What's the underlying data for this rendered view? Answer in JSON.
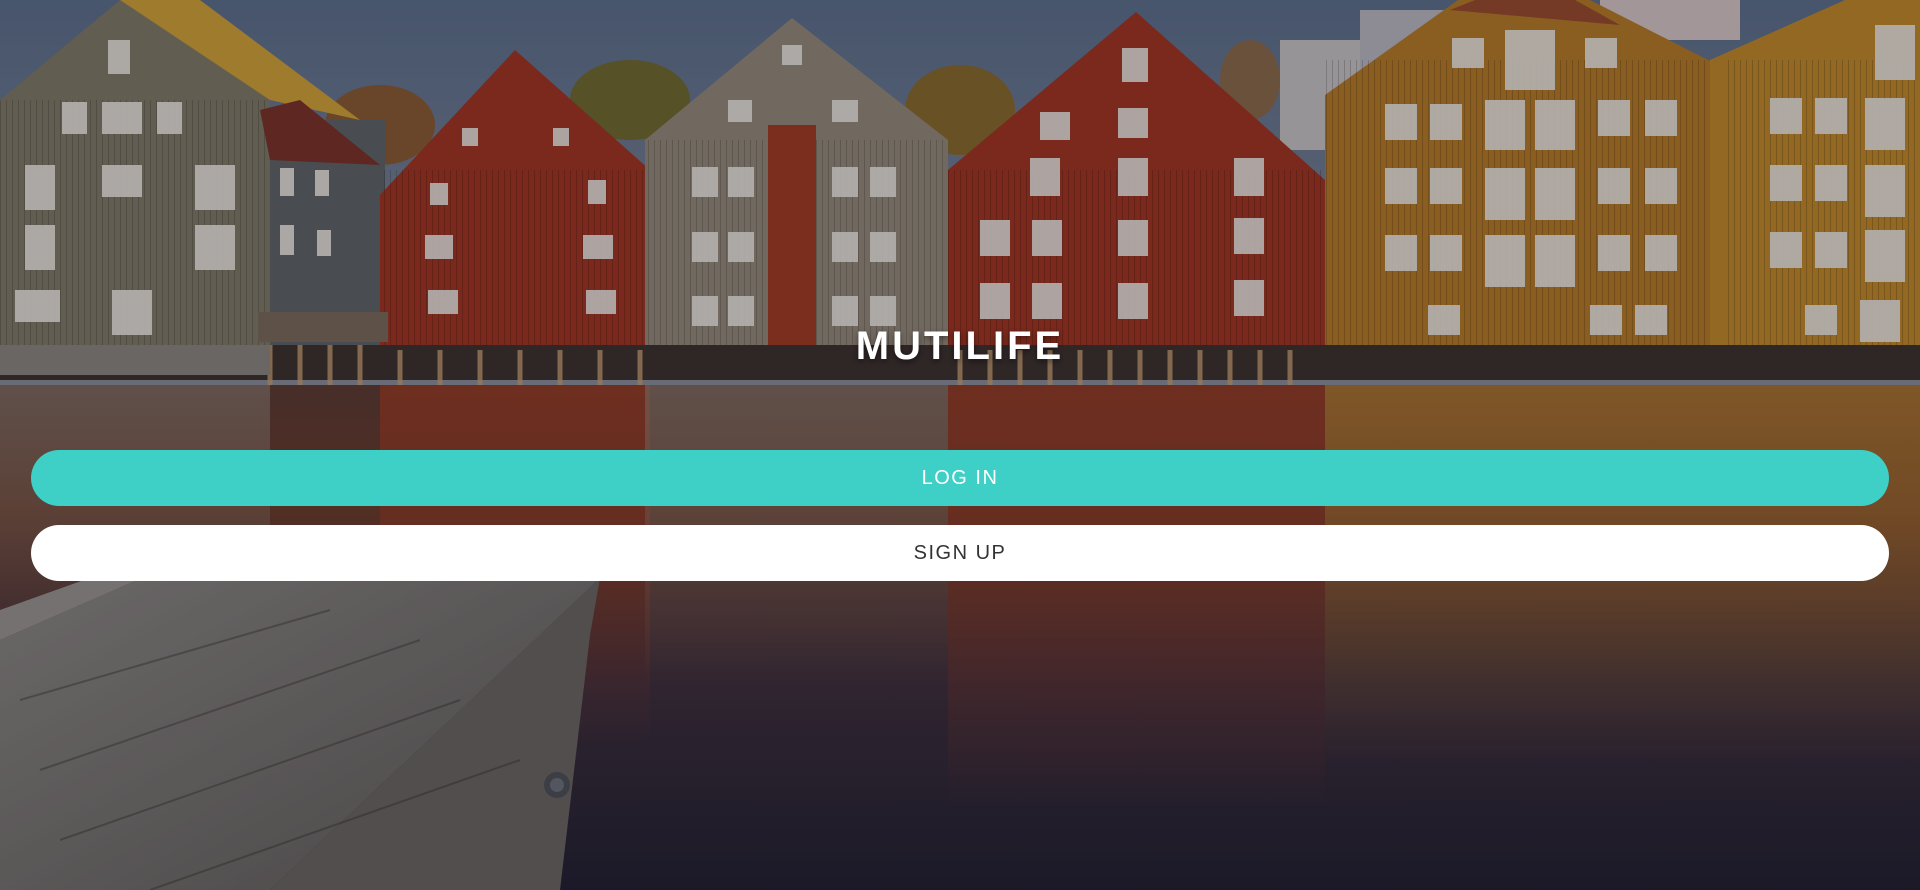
{
  "app": {
    "brand": "MUTILIFE"
  },
  "auth": {
    "login_label": "LOG IN",
    "signup_label": "SIGN UP"
  },
  "colors": {
    "accent": "#3ecfc6",
    "signup_bg": "#ffffff",
    "signup_text": "#333333",
    "brand_text": "#ffffff"
  },
  "background": {
    "description_icon": "harbor-houses-photo"
  }
}
